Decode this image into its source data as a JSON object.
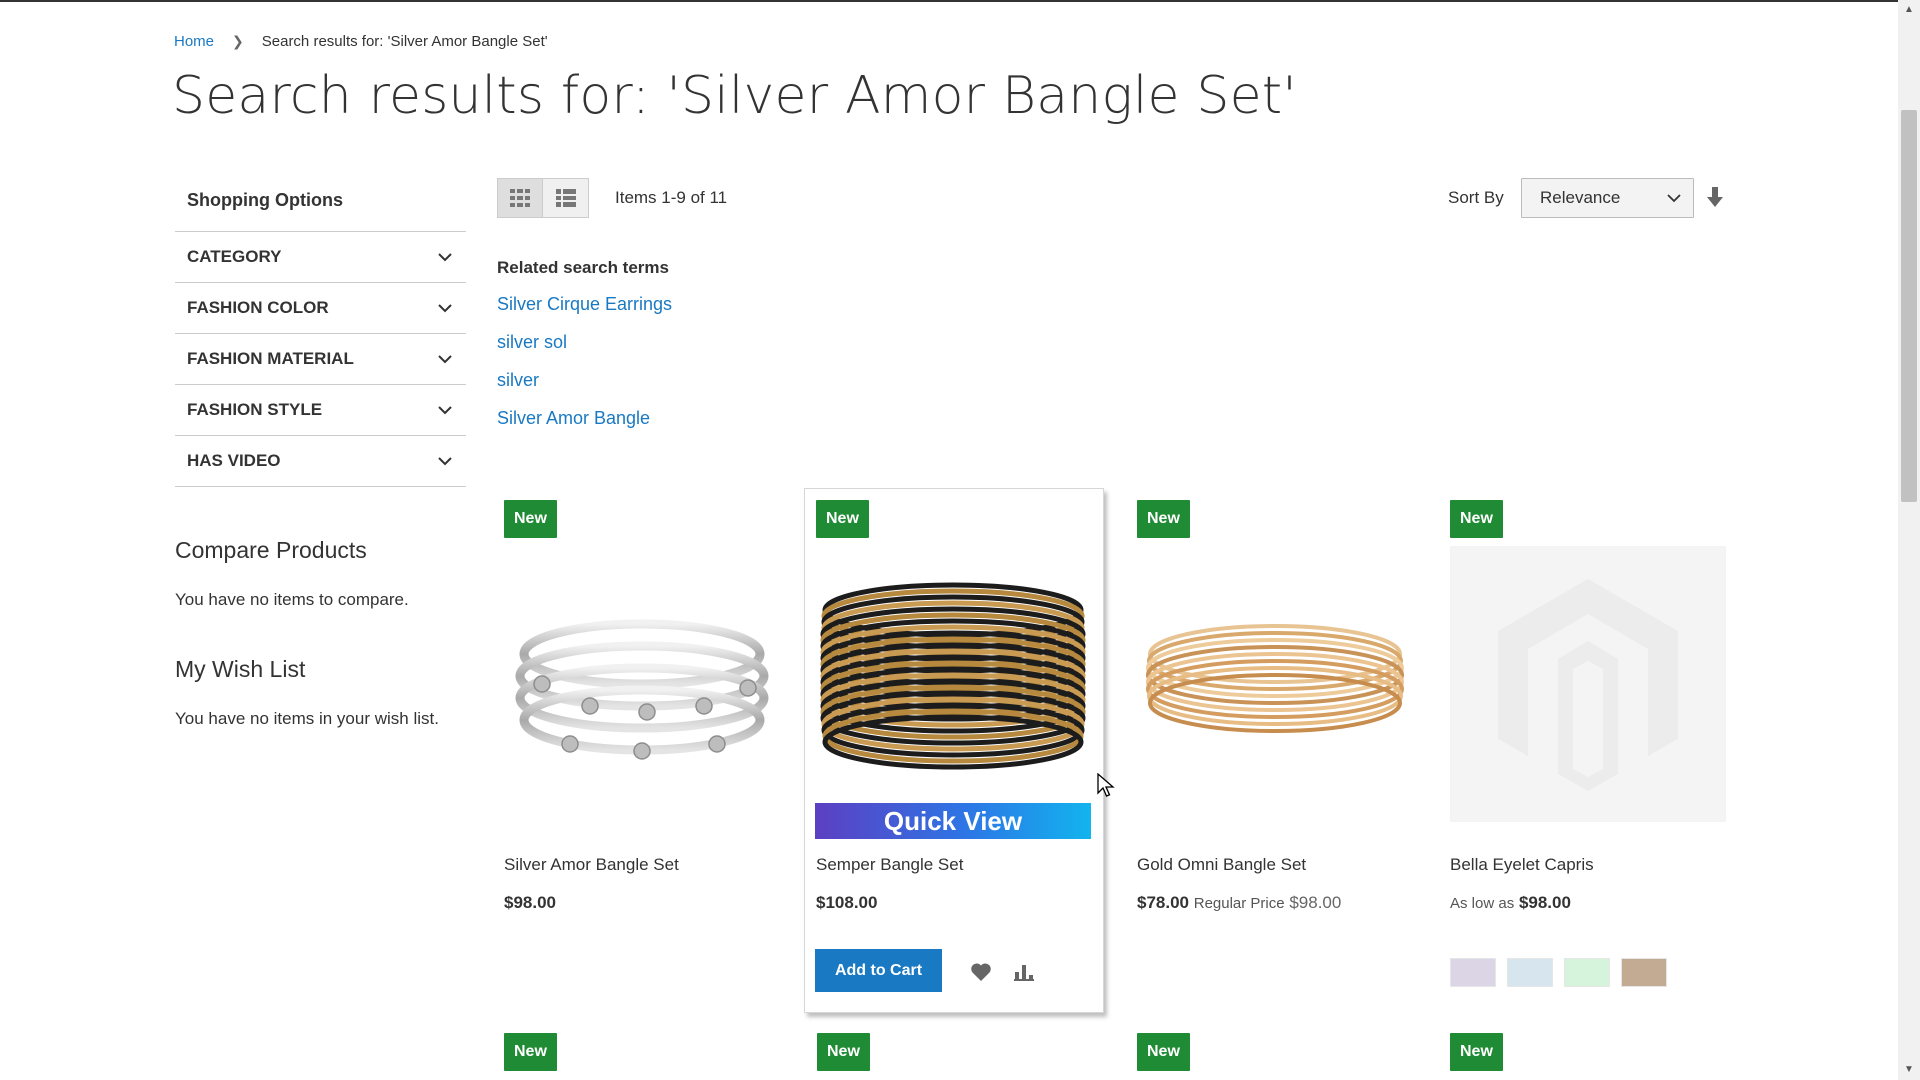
{
  "breadcrumb": {
    "home": "Home",
    "current": "Search results for: 'Silver Amor Bangle Set'"
  },
  "page_title": "Search results for: 'Silver Amor Bangle Set'",
  "sidebar": {
    "title": "Shopping Options",
    "filters": [
      {
        "label": "CATEGORY"
      },
      {
        "label": "FASHION COLOR"
      },
      {
        "label": "FASHION MATERIAL"
      },
      {
        "label": "FASHION STYLE"
      },
      {
        "label": "HAS VIDEO"
      }
    ],
    "compare_title": "Compare Products",
    "compare_empty": "You have no items to compare.",
    "wishlist_title": "My Wish List",
    "wishlist_empty": "You have no items in your wish list."
  },
  "toolbar": {
    "amount": "Items 1-9 of 11",
    "sort_label": "Sort By",
    "sort_value": "Relevance",
    "active_mode": "grid"
  },
  "related": {
    "title": "Related search terms",
    "terms": [
      "Silver Cirque Earrings",
      "silver sol",
      "silver",
      "Silver Amor Bangle"
    ]
  },
  "products": [
    {
      "badge": "New",
      "name": "Silver Amor Bangle Set",
      "price": "$98.00",
      "image": "silver-bangle-set"
    },
    {
      "badge": "New",
      "name": "Semper Bangle Set",
      "price": "$108.00",
      "image": "black-gold-bangle-set",
      "quick_view": "Quick View",
      "add_to_cart": "Add to Cart"
    },
    {
      "badge": "New",
      "name": "Gold Omni Bangle Set",
      "price": "$78.00",
      "regular_label": "Regular Price",
      "regular_price": "$98.00",
      "image": "gold-bangle-set"
    },
    {
      "badge": "New",
      "name": "Bella Eyelet Capris",
      "as_low_as": "As low as",
      "price": "$98.00",
      "image": "placeholder-logo",
      "swatches": [
        "#dcd5e5",
        "#d7e5ef",
        "#d6f3db",
        "#c3aa92"
      ]
    }
  ],
  "next_row_badges": [
    "New",
    "New",
    "New",
    "New"
  ],
  "colors": {
    "link": "#1979c3",
    "badge": "#208b35",
    "button": "#1979c3"
  }
}
